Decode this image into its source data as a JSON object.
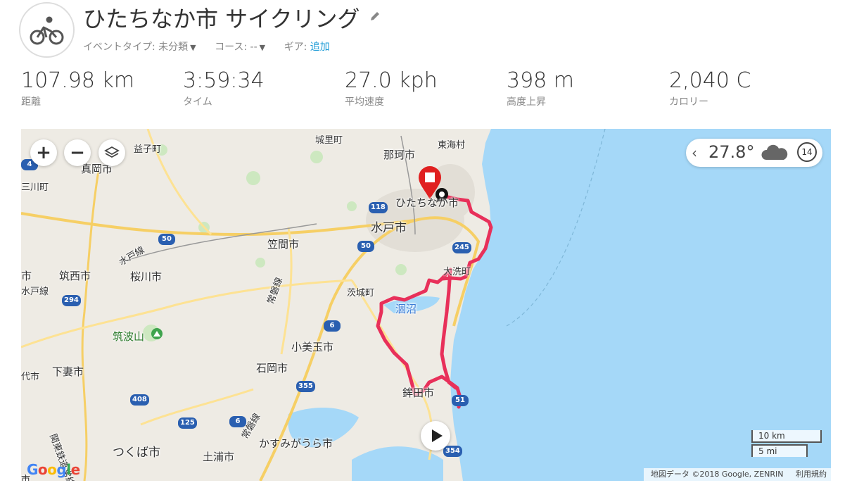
{
  "activity": {
    "title": "ひたちなか市 サイクリング",
    "icon": "cycling-icon",
    "edit_icon": "pencil-icon"
  },
  "meta": {
    "event_type_label": "イベントタイプ: 未分類",
    "course_label": "コース: --",
    "gear_label": "ギア:",
    "gear_add": "追加"
  },
  "stats": [
    {
      "value": "107.98 km",
      "label": "距離"
    },
    {
      "value": "3:59:34",
      "label": "タイム"
    },
    {
      "value": "27.0 kph",
      "label": "平均速度"
    },
    {
      "value": "398 m",
      "label": "高度上昇"
    },
    {
      "value": "2,040 C",
      "label": "カロリー"
    }
  ],
  "map": {
    "zoom_in": "+",
    "zoom_out": "−",
    "weather": {
      "temp": "27.8°",
      "wind_speed": "14",
      "icon": "cloud-icon"
    },
    "scale_km": "10 km",
    "scale_mi": "5 mi",
    "attribution": "地図データ ©2018 Google, ZENRIN",
    "terms": "利用規約",
    "google_logo": "Google",
    "labels": {
      "jouhoku": "城里町",
      "naka": "那珂市",
      "tokai": "東海村",
      "mashiko": "益子町",
      "moka": "真岡市",
      "mikawa": "三川町",
      "hitachinaka": "ひたちなか市",
      "mito": "水戸市",
      "kasama": "笠間市",
      "chikusei": "筑西市",
      "sakuragawa": "桜川市",
      "mito_line": "水戸線",
      "mito_line2": "水戸線",
      "oarai": "大洗町",
      "ibaraki": "茨城町",
      "hinuma": "涸沼",
      "joban": "常磐線",
      "tsukuba_san": "筑波山",
      "omitama": "小美玉市",
      "ishioka": "石岡市",
      "shimotsuma": "下妻市",
      "hokota": "鉾田市",
      "joban2": "常磐線",
      "kasumigaura": "かすみがうら市",
      "tsukuba": "つくば市",
      "tsuchiura": "土浦市",
      "kanto_line": "関東鉄道常総線",
      "edge_shi": "市",
      "edge_dai": "代市",
      "edge_shi2": "市"
    },
    "shields": [
      "118",
      "50",
      "50",
      "245",
      "294",
      "6",
      "355",
      "408",
      "6",
      "125",
      "354",
      "51",
      "4"
    ]
  },
  "colors": {
    "route": "#e8305a",
    "water": "#a5d8f8",
    "land": "#eeebe4",
    "link": "#1a9ad6",
    "start_marker": "#e02020"
  }
}
